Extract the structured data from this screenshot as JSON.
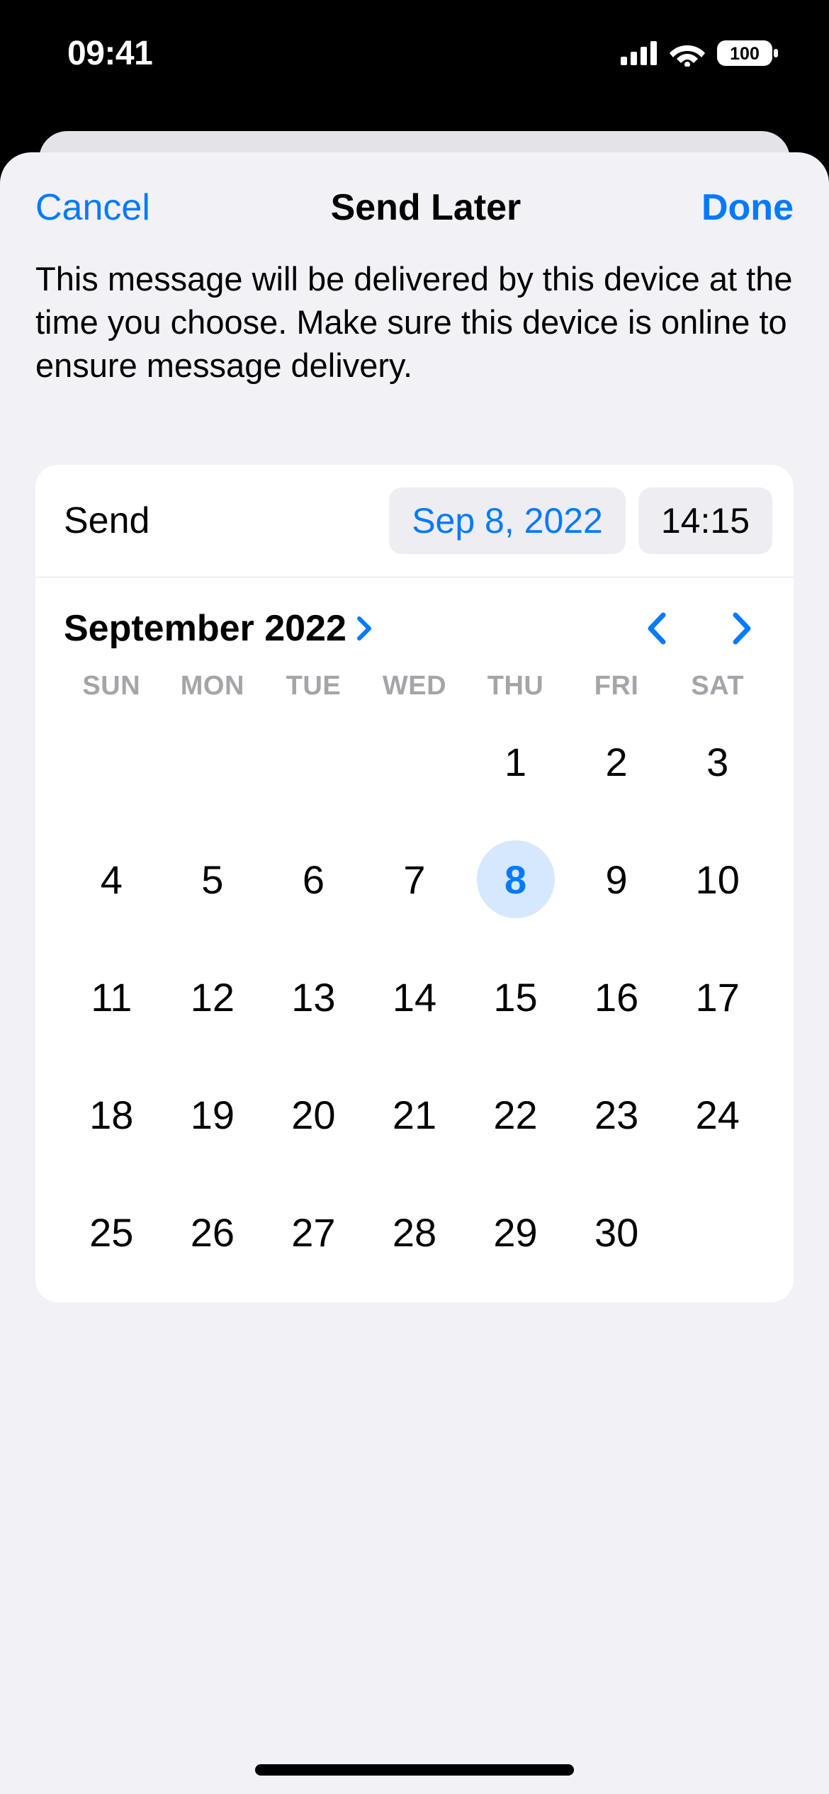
{
  "status": {
    "time": "09:41",
    "battery": "100"
  },
  "nav": {
    "cancel": "Cancel",
    "title": "Send Later",
    "done": "Done"
  },
  "description": "This message will be delivered by this device at the time you choose. Make sure this device is online to ensure message delivery.",
  "send": {
    "label": "Send",
    "date": "Sep 8, 2022",
    "time": "14:15"
  },
  "calendar": {
    "month_label": "September 2022",
    "weekdays": [
      "SUN",
      "MON",
      "TUE",
      "WED",
      "THU",
      "FRI",
      "SAT"
    ],
    "leading_blanks": 4,
    "days": [
      1,
      2,
      3,
      4,
      5,
      6,
      7,
      8,
      9,
      10,
      11,
      12,
      13,
      14,
      15,
      16,
      17,
      18,
      19,
      20,
      21,
      22,
      23,
      24,
      25,
      26,
      27,
      28,
      29,
      30
    ],
    "selected": 8
  }
}
